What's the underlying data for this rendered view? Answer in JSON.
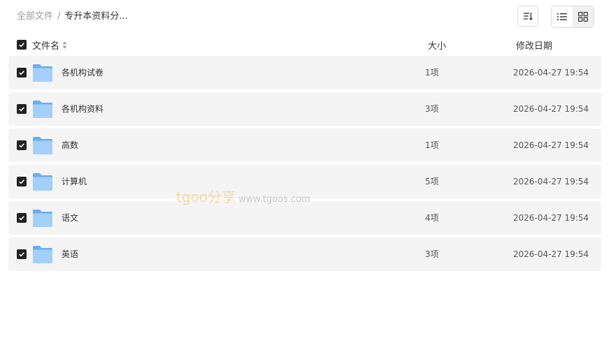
{
  "breadcrumb": {
    "root": "全部文件",
    "separator": "/",
    "current": "专升本资料分..."
  },
  "toolbar": {
    "sort_icon": "sort-icon",
    "list_view_icon": "list-view-icon",
    "grid_view_icon": "grid-view-icon"
  },
  "columns": {
    "name": "文件名",
    "size": "大小",
    "date": "修改日期"
  },
  "rows": [
    {
      "name": "各机构试卷",
      "size": "1项",
      "date": "2026-04-27 19:54"
    },
    {
      "name": "各机构资料",
      "size": "3项",
      "date": "2026-04-27 19:54"
    },
    {
      "name": "高数",
      "size": "1项",
      "date": "2026-04-27 19:54"
    },
    {
      "name": "计算机",
      "size": "5项",
      "date": "2026-04-27 19:54"
    },
    {
      "name": "语文",
      "size": "4项",
      "date": "2026-04-27 19:54"
    },
    {
      "name": "英语",
      "size": "3项",
      "date": "2026-04-27 19:54"
    }
  ],
  "watermark": {
    "brand": "tgoo分享",
    "url": "www.tgoos.com"
  },
  "colors": {
    "checkbox": "#222222",
    "row_bg": "#f4f4f4",
    "folder": "#7ab8f5",
    "muted_text": "#999999"
  }
}
